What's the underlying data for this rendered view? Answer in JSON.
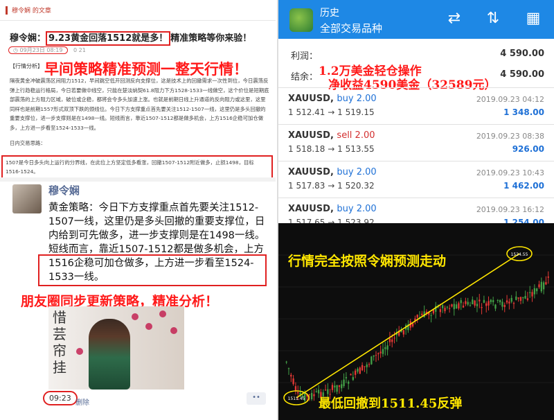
{
  "article": {
    "blog_name": "穆令娴 的文章",
    "title_prefix": "穆令娴：",
    "title_highlight": "9.23黄金回落1512就是多！",
    "title_suffix": "精准策略等你来验！",
    "date": "09月23日 08:19",
    "views": "0 21",
    "tag": "【行情分析】",
    "overlay_headline": "早间策略精准预测一整天行情！",
    "paragraph": "隔夜黄金冲破震荡区间阻力1512，早间跳空低开回测反向支撑位，这是技术上的回撤需求一次性到位，今日震荡反弹上行趋稳运行格局，今日若要做中线空，只能在楚淡纳契61.8阻力下方1528-1533一线做空，这个价位是短期底部震荡的上方阻力区域，破位或企稳，都将会令多头加速上涨。也就是前期日线上升通道的反向阻力或这里，这里同样也是前期1557形式双顶下跌的颈线位。今日下方支撑重点首先要关注1512-1507一线，这里仍是多头回撤的重要支撑位，进一步支撑则是在1498一线。短线而言，靠近1507-1512都是做多机会，上方1516企稳可加仓做多，上方进一步看至1524-1533一线。",
    "intraday_label": "日内交易思路：",
    "boxed_text": "1507是今日多头向上运行的分界线，在此位上方坚定低多看涨，回撤1507-1512附近做多，止损1498，目标1516-1524。"
  },
  "moment": {
    "author": "穆令娴",
    "text": "黄金策略：今日下方支撑重点首先要关注1512-1507一线，这里仍是多头回撤的重要支撑位，日内给到可先做多，进一步支撑则是在1498一线。短线而言，靠近1507-1512都是做多机会，上方1516企稳可加仓做多，上方进一步看至1524-1533一线。",
    "overlay_caption": "朋友圈同步更新策略，精准分析！",
    "photo_calligraphy": "惜芸帘挂",
    "time": "09:23",
    "delete_label": "删除",
    "more_label": "••"
  },
  "history": {
    "title": "历史",
    "subtitle": "全部交易品种",
    "icons": [
      "dollar-exchange-icon",
      "sort-icon",
      "calendar-icon"
    ],
    "profit_label": "利润：",
    "profit_value": "4 590.00",
    "balance_label": "结余：",
    "balance_value": "4 590.00",
    "overlay_note_1": "1.2万美金轻仓操作",
    "overlay_note_2": "净收益4590美金（32589元）",
    "trades": [
      {
        "symbol": "XAUUSD,",
        "side": "buy 2.00",
        "type": "buy",
        "open": "1 512.41",
        "close": "1 519.15",
        "date": "2019.09.23 04:12",
        "profit": "1 348.00"
      },
      {
        "symbol": "XAUUSD,",
        "side": "sell 2.00",
        "type": "sell",
        "open": "1 518.18",
        "close": "1 513.55",
        "date": "2019.09.23 08:38",
        "profit": "926.00"
      },
      {
        "symbol": "XAUUSD,",
        "side": "buy 2.00",
        "type": "buy",
        "open": "1 517.83",
        "close": "1 520.32",
        "date": "2019.09.23 10:43",
        "profit": "1 462.00"
      },
      {
        "symbol": "XAUUSD,",
        "side": "buy 2.00",
        "type": "buy",
        "open": "1 517.65",
        "close": "1 523.92",
        "date": "2019.09.23 16:12",
        "profit": "1 254.00"
      }
    ],
    "arrow": "→"
  },
  "chart": {
    "caption_top": "行情完全按照令娴预测走动",
    "caption_bottom": "最低回撤到1511.45反弹",
    "low_label": "1511.45",
    "high_label": "1524.55",
    "colors": {
      "up": "#e53935",
      "down": "#43a047",
      "trend": "#ffe600"
    }
  }
}
